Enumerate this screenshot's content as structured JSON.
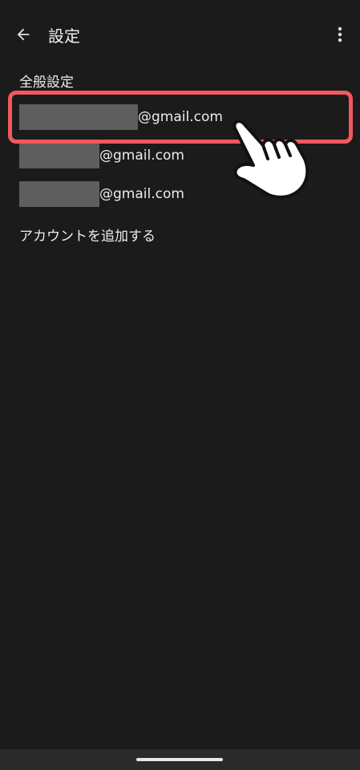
{
  "app_bar": {
    "title": "設定",
    "back_icon": "arrow-left-icon",
    "more_icon": "more-vert-icon"
  },
  "list": {
    "general_settings": "全般設定",
    "accounts": [
      {
        "email_suffix": "@gmail.com",
        "highlighted": true
      },
      {
        "email_suffix": "@gmail.com",
        "highlighted": false
      },
      {
        "email_suffix": "@gmail.com",
        "highlighted": false
      }
    ],
    "add_account": "アカウントを追加する"
  },
  "colors": {
    "background": "#1b1b1b",
    "highlight": "#f1595f",
    "redaction": "#5e5e5e"
  }
}
